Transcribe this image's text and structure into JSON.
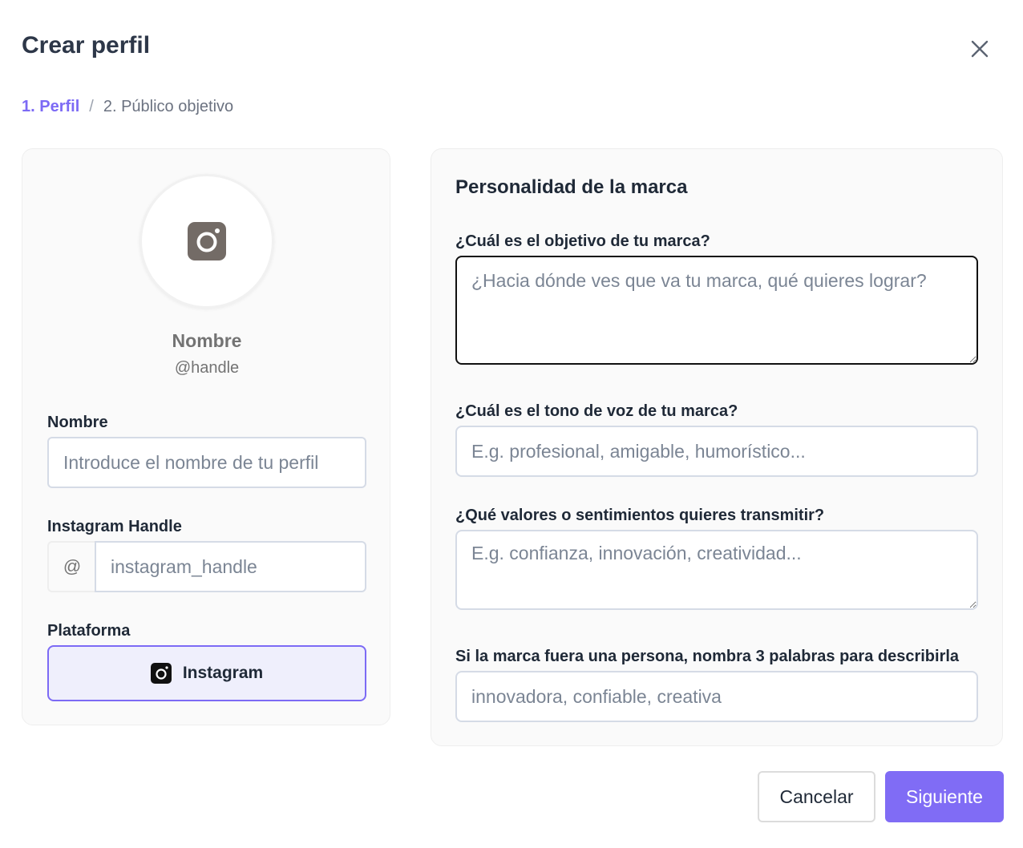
{
  "dialog": {
    "title": "Crear perfil"
  },
  "breadcrumb": {
    "step1": "1. Perfil",
    "separator": "/",
    "step2": "2. Público objetivo"
  },
  "profile_preview": {
    "icon": "instagram-icon",
    "name": "Nombre",
    "handle": "@handle"
  },
  "form_left": {
    "name_label": "Nombre",
    "name_placeholder": "Introduce el nombre de tu perfil",
    "handle_label": "Instagram Handle",
    "handle_prefix": "@",
    "handle_placeholder": "instagram_handle",
    "platform_label": "Plataforma",
    "platform_selected": "Instagram"
  },
  "brand_personality": {
    "section_title": "Personalidad de la marca",
    "objective_label": "¿Cuál es el objetivo de tu marca?",
    "objective_placeholder": "¿Hacia dónde ves que va tu marca, qué quieres lograr?",
    "tone_label": "¿Cuál es el tono de voz de tu marca?",
    "tone_placeholder": "E.g. profesional, amigable, humorístico...",
    "values_label": "¿Qué valores o sentimientos quieres transmitir?",
    "values_placeholder": "E.g. confianza, innovación, creatividad...",
    "words_label": "Si la marca fuera una persona, nombra 3 palabras para describirla",
    "words_placeholder": "innovadora, confiable, creativa"
  },
  "footer": {
    "cancel_label": "Cancelar",
    "next_label": "Siguiente"
  },
  "colors": {
    "accent": "#806cf5",
    "accent_bg": "#efeffc",
    "title": "#2d3748"
  }
}
